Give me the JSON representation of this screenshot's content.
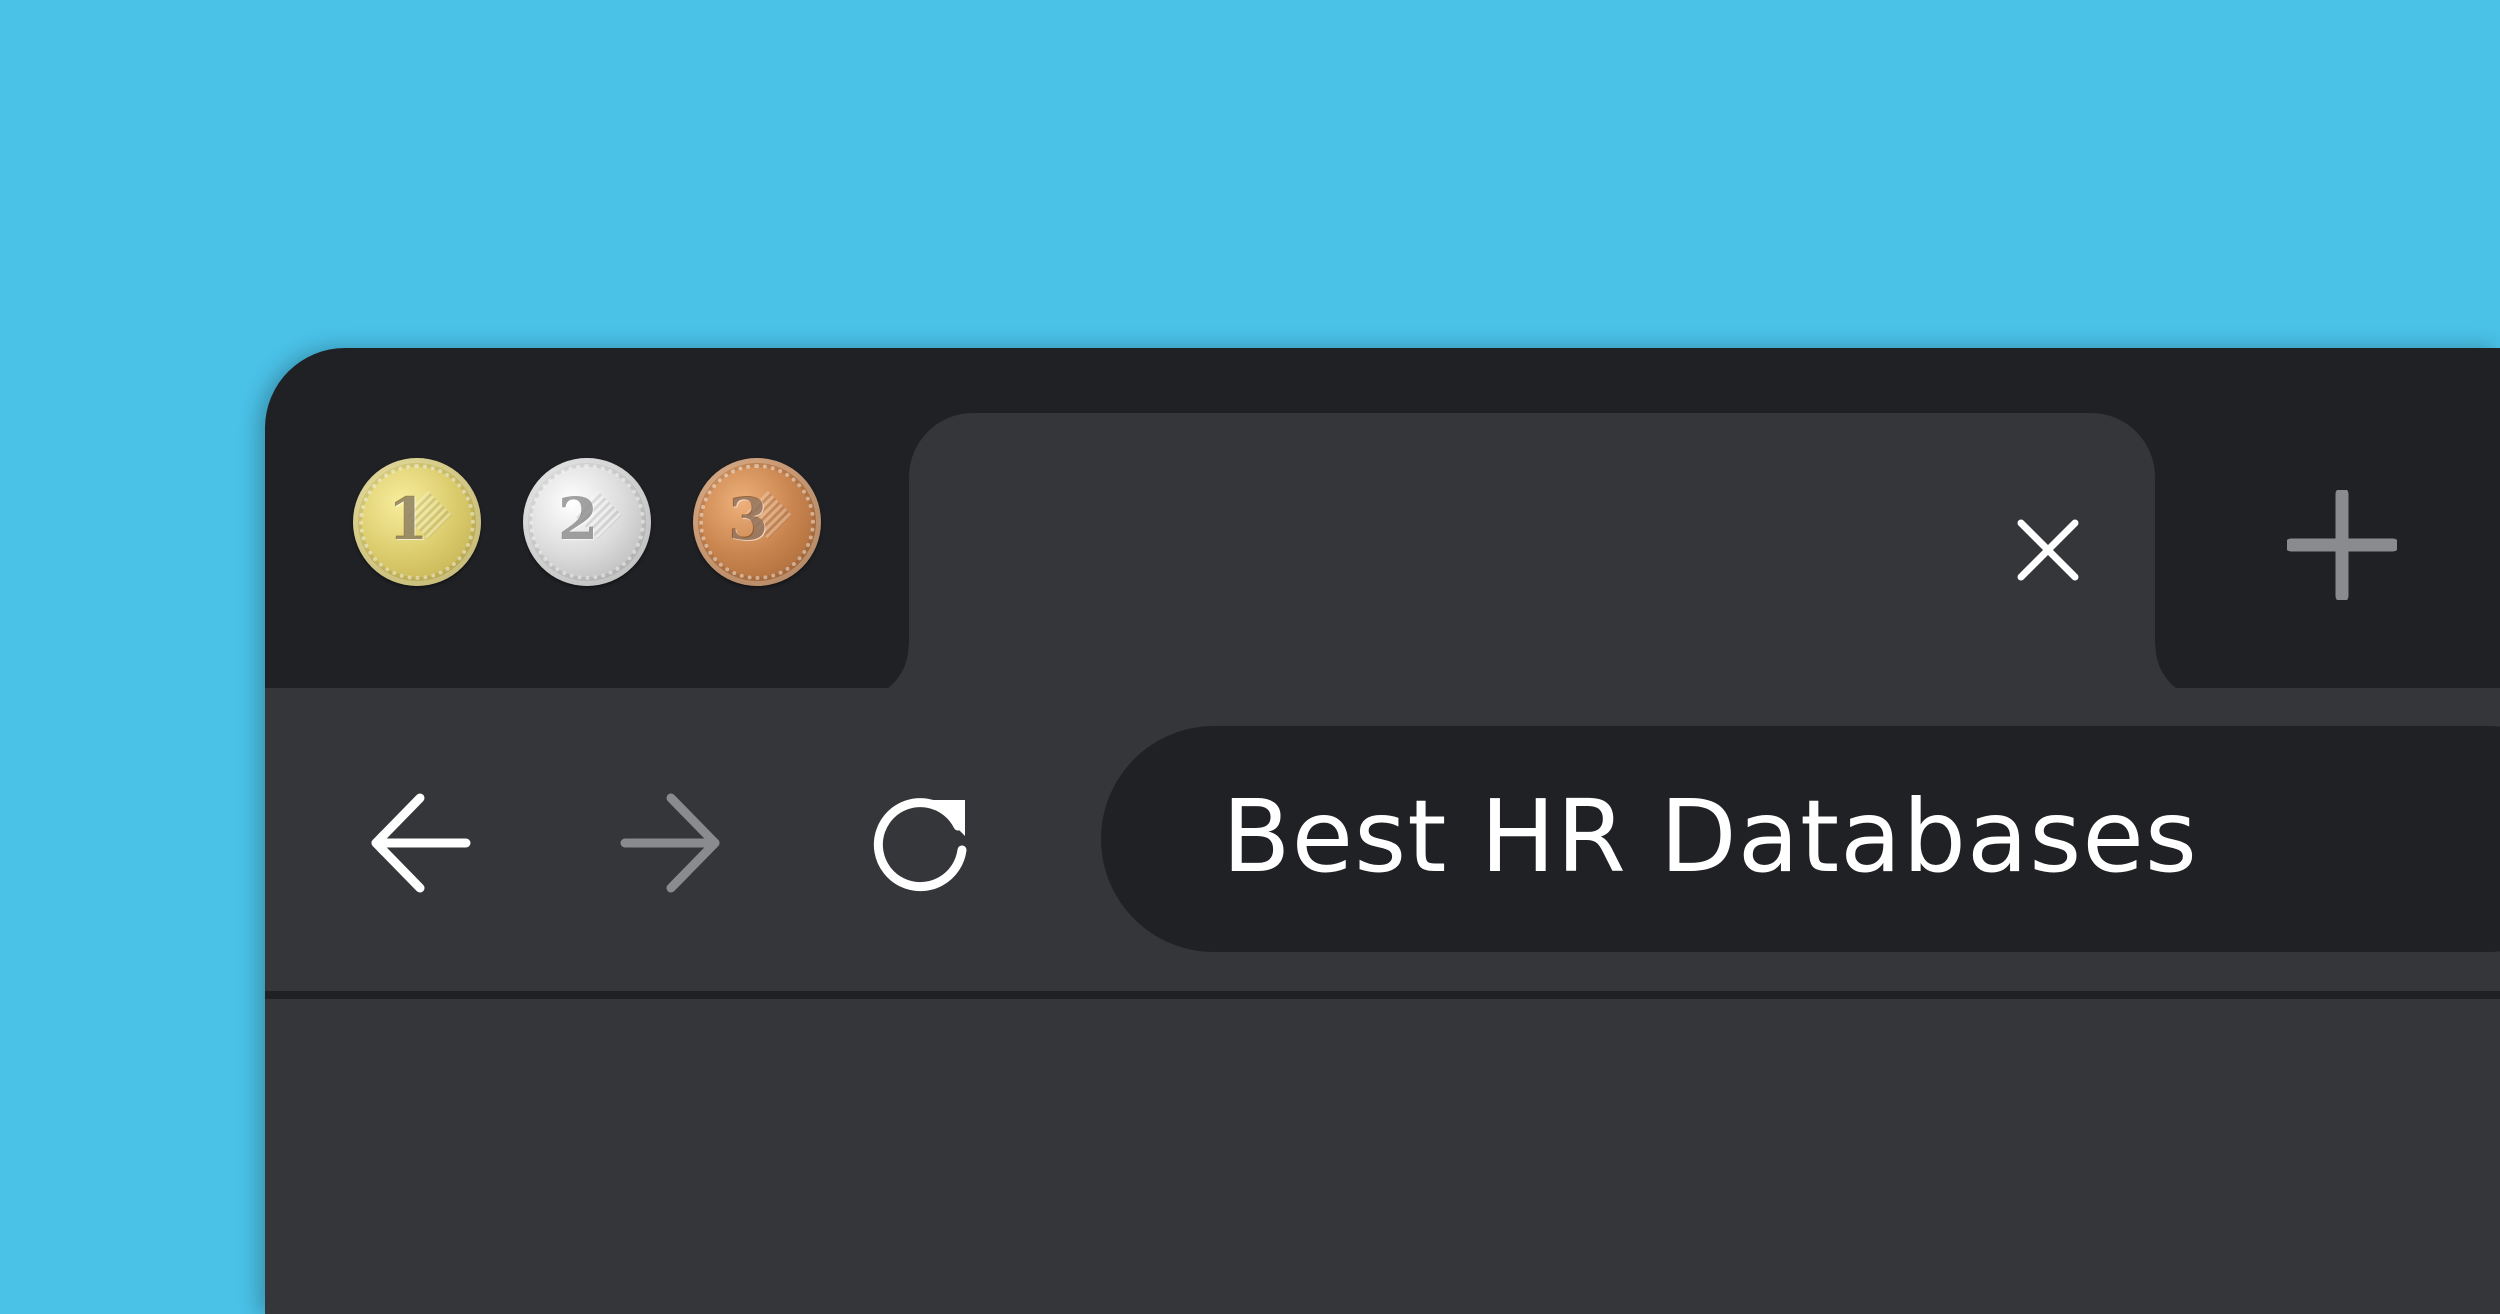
{
  "window_controls": [
    {
      "label": "1",
      "metal": "gold",
      "color": "#dccd6f"
    },
    {
      "label": "2",
      "metal": "silver",
      "color": "#dcdcdc"
    },
    {
      "label": "3",
      "metal": "bronze",
      "color": "#c98550"
    }
  ],
  "tab": {
    "close_icon": "close-icon"
  },
  "new_tab_icon": "plus-icon",
  "toolbar": {
    "back_icon": "arrow-left-icon",
    "forward_icon": "arrow-right-icon",
    "reload_icon": "reload-icon"
  },
  "address_bar": {
    "text": "Best HR Databases"
  },
  "colors": {
    "background": "#4ac1e7",
    "window_frame": "#202125",
    "tab_and_toolbar": "#35363a",
    "icon_active": "#ffffff",
    "icon_disabled": "#8a8b8e"
  }
}
